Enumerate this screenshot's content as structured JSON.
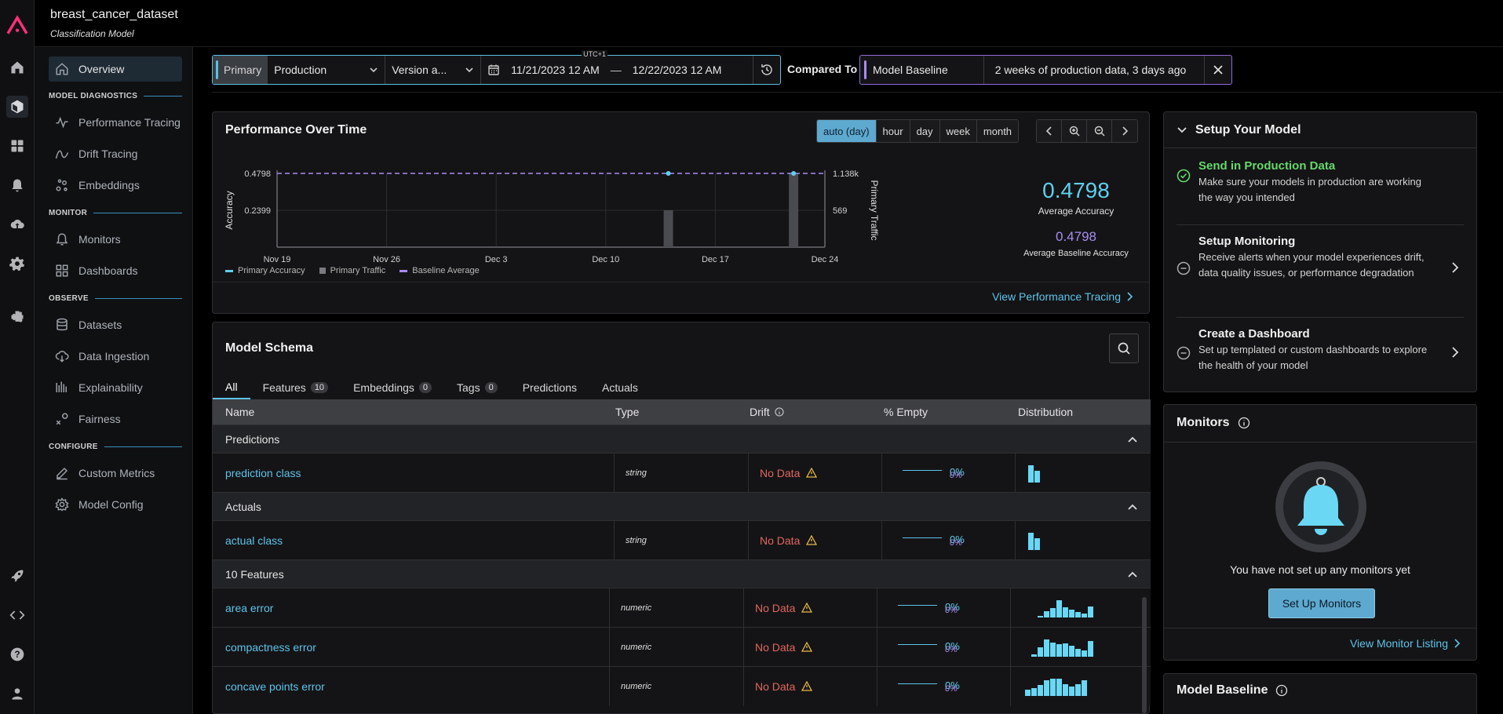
{
  "header": {
    "dataset_name": "breast_cancer_dataset",
    "model_type": "Classification Model"
  },
  "sidebar": {
    "overview": "Overview",
    "sections": {
      "model_diagnostics": "MODEL DIAGNOSTICS",
      "monitor": "MONITOR",
      "observe": "OBSERVE",
      "configure": "CONFIGURE"
    },
    "items": {
      "performance_tracing": "Performance Tracing",
      "drift_tracing": "Drift Tracing",
      "embeddings": "Embeddings",
      "monitors": "Monitors",
      "dashboards": "Dashboards",
      "datasets": "Datasets",
      "data_ingestion": "Data Ingestion",
      "explainability": "Explainability",
      "fairness": "Fairness",
      "custom_metrics": "Custom Metrics",
      "model_config": "Model Config"
    }
  },
  "filter": {
    "primary_label": "Primary",
    "environment": "Production",
    "version": "Version a...",
    "timezone": "UTC+1",
    "start_date": "11/21/2023 12 AM",
    "dash": "—",
    "end_date": "12/22/2023 12 AM",
    "compared_to_label": "Compared To",
    "baseline": "Model Baseline",
    "baseline_desc": "2 weeks of production data, 3 days ago"
  },
  "performance": {
    "title": "Performance Over Time",
    "granularities": [
      "auto (day)",
      "hour",
      "day",
      "week",
      "month"
    ],
    "avg_accuracy": "0.4798",
    "avg_accuracy_label": "Average Accuracy",
    "avg_baseline": "0.4798",
    "avg_baseline_label": "Average Baseline Accuracy",
    "view_link": "View Performance Tracing",
    "legend": [
      "Primary Accuracy",
      "Primary Traffic",
      "Baseline Average"
    ]
  },
  "chart_data": {
    "type": "bar",
    "ylabel": "Accuracy",
    "y2label": "Primary Traffic",
    "y_ticks": [
      "0.4798",
      "0.2399"
    ],
    "y2_ticks": [
      "1.138k",
      "569"
    ],
    "x_ticks": [
      "Nov 19",
      "Nov 26",
      "Dec 3",
      "Dec 10",
      "Dec 17",
      "Dec 24"
    ],
    "ylim": [
      0,
      0.4798
    ],
    "y2lim": [
      0,
      1138
    ],
    "series": [
      {
        "name": "Primary Traffic",
        "x": [
          "Dec 14",
          "Dec 22"
        ],
        "values": [
          569,
          1138
        ]
      },
      {
        "name": "Primary Accuracy",
        "x": [
          "Dec 14",
          "Dec 22"
        ],
        "values": [
          0.4798,
          0.4798
        ]
      },
      {
        "name": "Baseline Average",
        "values": [
          0.4798
        ]
      }
    ],
    "colors": {
      "traffic": "#4a4b50",
      "accuracy": "#5fd0ef",
      "baseline": "#a98cf0"
    }
  },
  "schema": {
    "title": "Model Schema",
    "tabs": [
      {
        "label": "All",
        "count": null
      },
      {
        "label": "Features",
        "count": "10"
      },
      {
        "label": "Embeddings",
        "count": "0"
      },
      {
        "label": "Tags",
        "count": "0"
      },
      {
        "label": "Predictions",
        "count": null
      },
      {
        "label": "Actuals",
        "count": null
      }
    ],
    "columns": {
      "name": "Name",
      "type": "Type",
      "drift": "Drift",
      "empty": "% Empty",
      "distribution": "Distribution"
    },
    "groups": {
      "predictions": "Predictions",
      "actuals": "Actuals",
      "features": "10 Features"
    },
    "rows": [
      {
        "name": "prediction class",
        "type": "string",
        "drift": "No Data",
        "empty1": "0%",
        "empty2": "0%"
      },
      {
        "name": "actual class",
        "type": "string",
        "drift": "No Data",
        "empty1": "0%",
        "empty2": "0%"
      },
      {
        "name": "area error",
        "type": "numeric",
        "drift": "No Data",
        "empty1": "0%",
        "empty2": "0%"
      },
      {
        "name": "compactness error",
        "type": "numeric",
        "drift": "No Data",
        "empty1": "0%",
        "empty2": "0%"
      },
      {
        "name": "concave points error",
        "type": "numeric",
        "drift": "No Data",
        "empty1": "0%",
        "empty2": "0%"
      }
    ]
  },
  "setup": {
    "title": "Setup Your Model",
    "steps": [
      {
        "title": "Send in Production Data",
        "desc": "Make sure your models in production are working the way you intended"
      },
      {
        "title": "Setup Monitoring",
        "desc": "Receive alerts when your model experiences drift, data quality issues, or performance degradation"
      },
      {
        "title": "Create a Dashboard",
        "desc": "Set up templated or custom dashboards to explore the health of your model"
      }
    ]
  },
  "monitors": {
    "title": "Monitors",
    "empty_msg": "You have not set up any monitors yet",
    "button": "Set Up Monitors",
    "link": "View Monitor Listing"
  },
  "baseline_card": {
    "title": "Model Baseline"
  }
}
